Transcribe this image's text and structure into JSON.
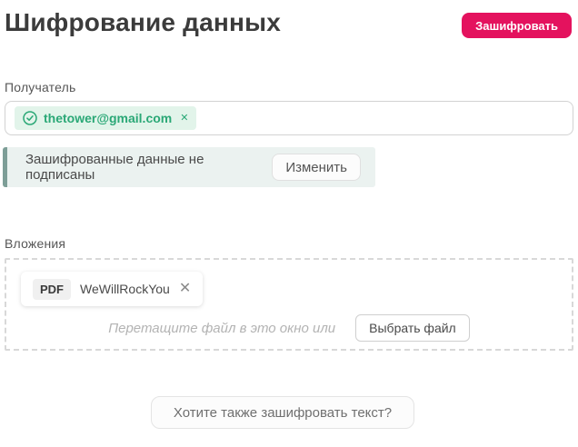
{
  "page": {
    "title": "Шифрование данных",
    "encrypt_button_label": "Зашифровать"
  },
  "recipient": {
    "label": "Получатель",
    "chip": {
      "email": "thetower@gmail.com",
      "check_icon": "circled-checkmark",
      "remove_glyph": "✕"
    }
  },
  "signature_banner": {
    "text": "Зашифрованные данные не подписаны",
    "change_button_label": "Изменить"
  },
  "attachments": {
    "label": "Вложения",
    "file": {
      "type_badge": "PDF",
      "name": "WeWillRockYou",
      "remove_glyph": "✕"
    },
    "dropzone_hint": "Перетащите файл в это окно или",
    "choose_file_button_label": "Выбрать файл"
  },
  "footer": {
    "encrypt_text_button_label": "Хотите также зашифровать текст?"
  },
  "colors": {
    "accent_pink": "#e4125e",
    "success_green": "#2aa876",
    "chip_background": "#e2f4ea",
    "banner_background": "#ebf2f0",
    "banner_stripe": "#7d9e97",
    "title_text": "#3b3b3b",
    "muted_text": "#b3b3b3"
  }
}
